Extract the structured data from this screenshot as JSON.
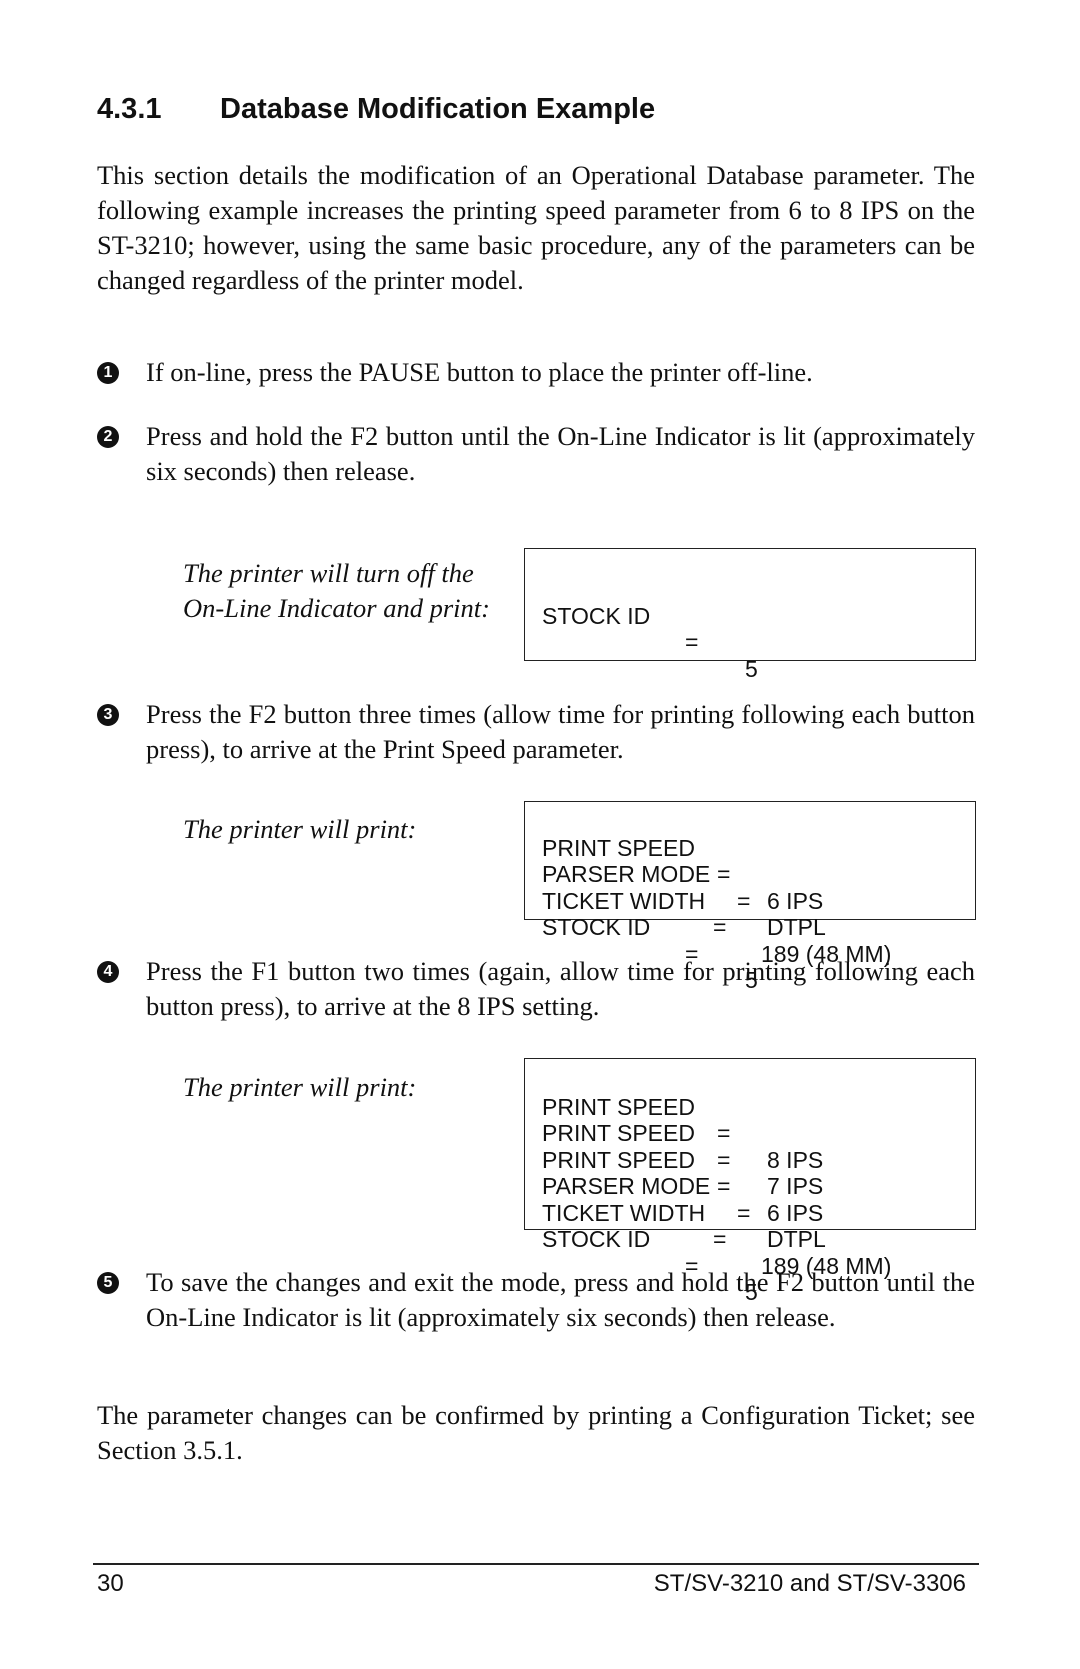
{
  "section": {
    "number": "4.3.1",
    "title": "Database Modification Example"
  },
  "intro": "This section details the modification of an Operational Database parameter. The following example increases the printing speed parameter from 6 to 8 IPS on the ST-3210; however, using the same basic procedure, any of the parameters can be changed regardless of the printer model.",
  "steps": [
    {
      "bullet": "1",
      "text": "If on-line, press the PAUSE button to place the printer off-line."
    },
    {
      "bullet": "2",
      "text": "Press and hold the F2 button until the On-Line Indicator is lit (approximately six seconds) then release."
    },
    {
      "bullet": "3",
      "text": "Press the F2 button three times (allow time for printing following each button press), to arrive at the Print Speed parameter."
    },
    {
      "bullet": "4",
      "text": "Press the F1 button two times (again, allow time for printing following each button press), to arrive at the 8 IPS setting."
    },
    {
      "bullet": "5",
      "text": "To save the changes and exit the mode, press and hold the F2 button until the On-Line Indicator is lit (approximately six seconds) then release."
    }
  ],
  "captions": {
    "after_step2": "The printer will turn off the On-Line Indicator and print:",
    "after_step3": "The printer will print:",
    "after_step4": "The printer will print:"
  },
  "printouts": {
    "after_step2": [
      {
        "key": "STOCK ID",
        "eq": "=",
        "val": "5"
      }
    ],
    "after_step3": [
      {
        "key": "PRINT SPEED",
        "eq": "=",
        "val": "6 IPS"
      },
      {
        "key": "PARSER MODE",
        "eq": "=",
        "val": "DTPL"
      },
      {
        "key": "TICKET WIDTH",
        "eq": "=",
        "val": "189 (48 MM)"
      },
      {
        "key": "STOCK ID",
        "eq": "=",
        "val": "5"
      }
    ],
    "after_step4": [
      {
        "key": "PRINT SPEED",
        "eq": "=",
        "val": "8 IPS"
      },
      {
        "key": "PRINT SPEED",
        "eq": "=",
        "val": "7 IPS"
      },
      {
        "key": "PRINT SPEED",
        "eq": "=",
        "val": "6 IPS"
      },
      {
        "key": "PARSER MODE",
        "eq": "=",
        "val": "DTPL"
      },
      {
        "key": "TICKET WIDTH",
        "eq": "=",
        "val": "189 (48 MM)"
      },
      {
        "key": "STOCK ID",
        "eq": "=",
        "val": "5"
      }
    ]
  },
  "closing": "The parameter changes can be confirmed by printing a Configuration Ticket; see Section 3.5.1.",
  "footer": {
    "page_number": "30",
    "doc_title": "ST/SV-3210 and ST/SV-3306"
  }
}
